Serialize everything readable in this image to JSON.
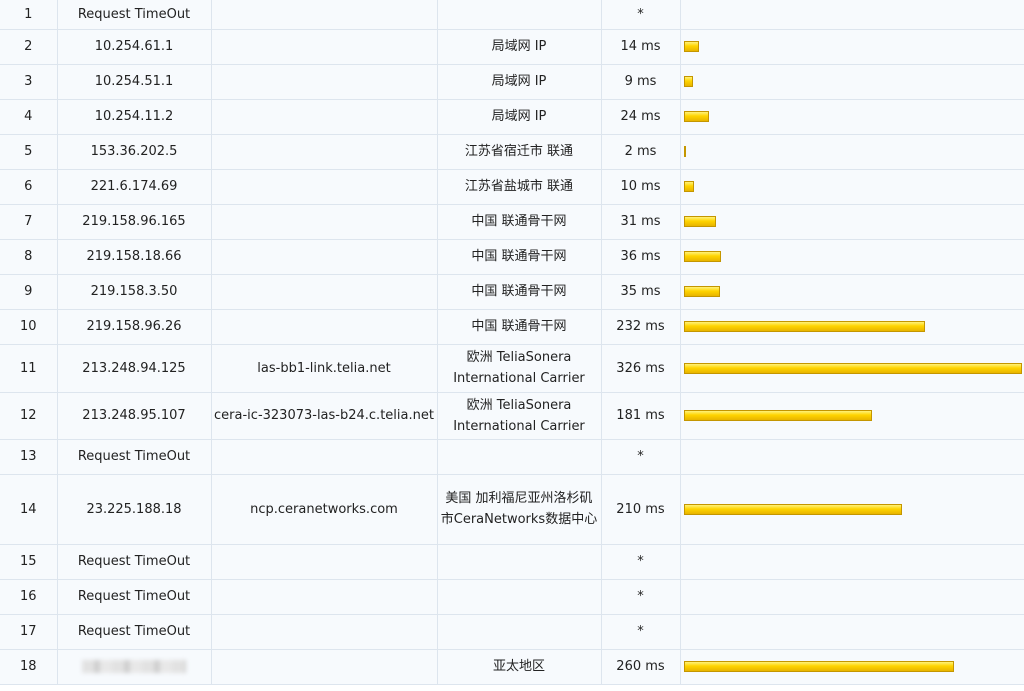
{
  "hops": [
    {
      "n": "1",
      "ip": "Request TimeOut",
      "host": "",
      "loc": "",
      "time": "*",
      "ms": null
    },
    {
      "n": "2",
      "ip": "10.254.61.1",
      "host": "",
      "loc": "局域网 IP",
      "time": "14 ms",
      "ms": 14
    },
    {
      "n": "3",
      "ip": "10.254.51.1",
      "host": "",
      "loc": "局域网 IP",
      "time": "9 ms",
      "ms": 9
    },
    {
      "n": "4",
      "ip": "10.254.11.2",
      "host": "",
      "loc": "局域网 IP",
      "time": "24 ms",
      "ms": 24
    },
    {
      "n": "5",
      "ip": "153.36.202.5",
      "host": "",
      "loc": "江苏省宿迁市 联通",
      "time": "2 ms",
      "ms": 2
    },
    {
      "n": "6",
      "ip": "221.6.174.69",
      "host": "",
      "loc": "江苏省盐城市 联通",
      "time": "10 ms",
      "ms": 10
    },
    {
      "n": "7",
      "ip": "219.158.96.165",
      "host": "",
      "loc": "中国 联通骨干网",
      "time": "31 ms",
      "ms": 31
    },
    {
      "n": "8",
      "ip": "219.158.18.66",
      "host": "",
      "loc": "中国 联通骨干网",
      "time": "36 ms",
      "ms": 36
    },
    {
      "n": "9",
      "ip": "219.158.3.50",
      "host": "",
      "loc": "中国 联通骨干网",
      "time": "35 ms",
      "ms": 35
    },
    {
      "n": "10",
      "ip": "219.158.96.26",
      "host": "",
      "loc": "中国 联通骨干网",
      "time": "232 ms",
      "ms": 232
    },
    {
      "n": "11",
      "ip": "213.248.94.125",
      "host": "las-bb1-link.telia.net",
      "loc": "欧洲 TeliaSonera International Carrier",
      "time": "326 ms",
      "ms": 326
    },
    {
      "n": "12",
      "ip": "213.248.95.107",
      "host": "cera-ic-323073-las-b24.c.telia.net",
      "loc": "欧洲 TeliaSonera International Carrier",
      "time": "181 ms",
      "ms": 181
    },
    {
      "n": "13",
      "ip": "Request TimeOut",
      "host": "",
      "loc": "",
      "time": "*",
      "ms": null
    },
    {
      "n": "14",
      "ip": "23.225.188.18",
      "host": "ncp.ceranetworks.com",
      "loc": "美国 加利福尼亚州洛杉矶市CeraNetworks数据中心",
      "time": "210 ms",
      "ms": 210
    },
    {
      "n": "15",
      "ip": "Request TimeOut",
      "host": "",
      "loc": "",
      "time": "*",
      "ms": null
    },
    {
      "n": "16",
      "ip": "Request TimeOut",
      "host": "",
      "loc": "",
      "time": "*",
      "ms": null
    },
    {
      "n": "17",
      "ip": "Request TimeOut",
      "host": "",
      "loc": "",
      "time": "*",
      "ms": null
    },
    {
      "n": "18",
      "ip": "",
      "ip_blurred": true,
      "host": "",
      "loc": "亚太地区",
      "time": "260 ms",
      "ms": 260
    }
  ],
  "bar_scale_max_ms": 326,
  "colors": {
    "bar": "#ffd400",
    "grid": "#dde5ee",
    "row_bg": "#f7fafd"
  }
}
